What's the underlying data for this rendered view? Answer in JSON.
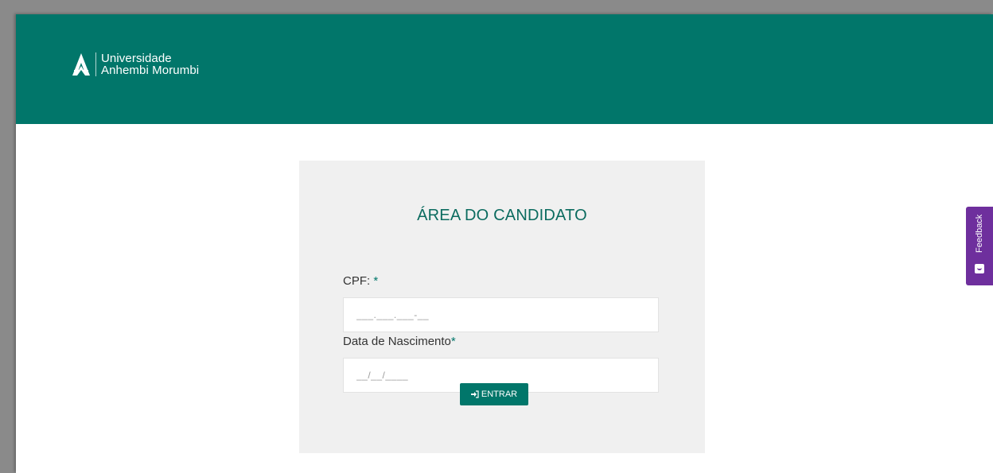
{
  "brand": {
    "line1": "Universidade",
    "line2": "Anhembi Morumbi",
    "header_color": "#01766a"
  },
  "login": {
    "title": "ÁREA DO CANDIDATO",
    "cpf_label": "CPF:",
    "cpf_required": "*",
    "cpf_placeholder": "___.___.___-__",
    "birth_label": "Data de Nascimento",
    "birth_required": "*",
    "birth_placeholder": "__/__/____",
    "submit_label": "ENTRAR",
    "submit_icon": "sign-in-icon"
  },
  "feedback": {
    "label": "Feedback",
    "icon": "smile-icon",
    "color": "#6e2f9d"
  }
}
